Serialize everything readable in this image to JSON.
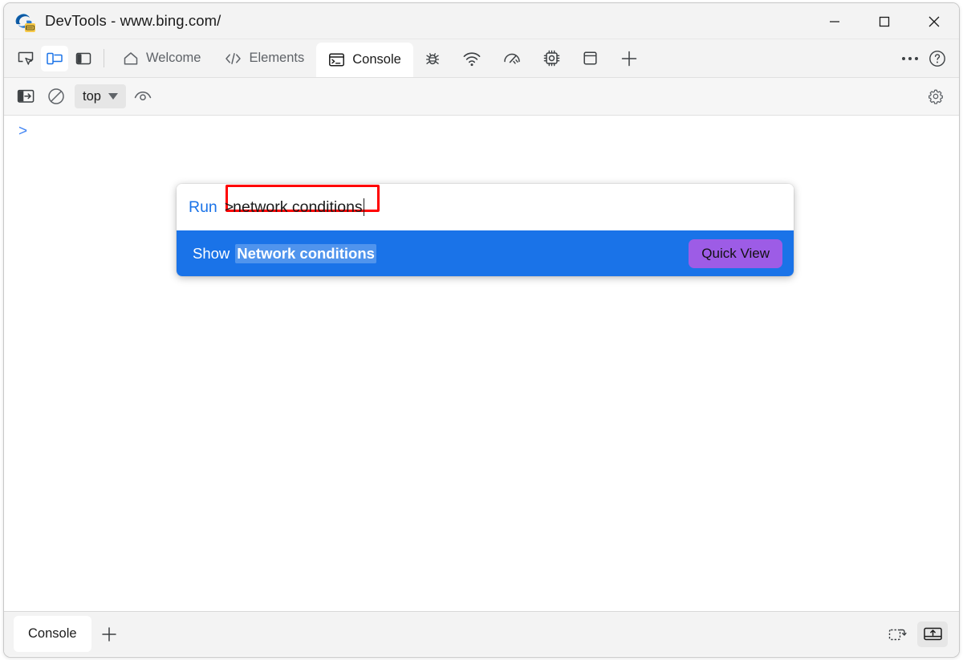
{
  "window": {
    "title": "DevTools - www.bing.com/",
    "logo_icon": "edge-devtools-logo",
    "controls": {
      "minimize": "minimize-button",
      "maximize": "maximize-button",
      "close": "close-button"
    }
  },
  "tabstrip": {
    "tools": [
      {
        "name": "inspect-element-icon",
        "label": "Inspect"
      },
      {
        "name": "device-emulation-icon",
        "label": "Toggle device emulation",
        "active": true
      },
      {
        "name": "sidebar-toggle-icon",
        "label": "Toggle sidebar"
      }
    ],
    "tabs": [
      {
        "label": "Welcome",
        "icon": "home-icon",
        "selected": false
      },
      {
        "label": "Elements",
        "icon": "code-brackets-icon",
        "selected": false
      },
      {
        "label": "Console",
        "icon": "console-icon",
        "selected": true
      },
      {
        "label": "Sources",
        "icon": "bug-icon",
        "selected": false,
        "icon_only": true
      },
      {
        "label": "Network",
        "icon": "wifi-icon",
        "selected": false,
        "icon_only": true
      },
      {
        "label": "Performance",
        "icon": "gauge-icon",
        "selected": false,
        "icon_only": true
      },
      {
        "label": "Memory",
        "icon": "chip-icon",
        "selected": false,
        "icon_only": true
      },
      {
        "label": "Application",
        "icon": "application-panel-icon",
        "selected": false,
        "icon_only": true
      },
      {
        "label": "More tools",
        "icon": "plus-icon",
        "selected": false,
        "icon_only": true
      }
    ],
    "more_button": "more-tools-icon",
    "help_button": "help-icon"
  },
  "console_toolbar": {
    "sidebar_toggle": "console-sidebar-icon",
    "clear_console": "clear-console-icon",
    "context_value": "top",
    "context_caret": "chevron-down-icon",
    "eye_filter": "live-expression-icon",
    "settings": "gear-icon"
  },
  "console": {
    "prompt": ">"
  },
  "palette": {
    "run_label": "Run",
    "prefix": ">",
    "query": "network conditions",
    "results": [
      {
        "prefix": "Show",
        "match": "Network conditions",
        "action_label": "Quick View",
        "selected": true
      }
    ]
  },
  "drawer": {
    "tab_label": "Console",
    "add_tab_icon": "plus-icon",
    "right_icons": [
      {
        "name": "restore-drawer-icon",
        "active": false
      },
      {
        "name": "dock-to-bottom-icon",
        "active": true
      }
    ]
  },
  "colors": {
    "accent_blue": "#1a73e8",
    "link_blue": "#1a73e8",
    "annotation_red": "#ff0000",
    "quick_view_purple": "#9d5ce6",
    "titlebar_bg": "#f3f3f3",
    "panel_bg": "#ffffff"
  }
}
